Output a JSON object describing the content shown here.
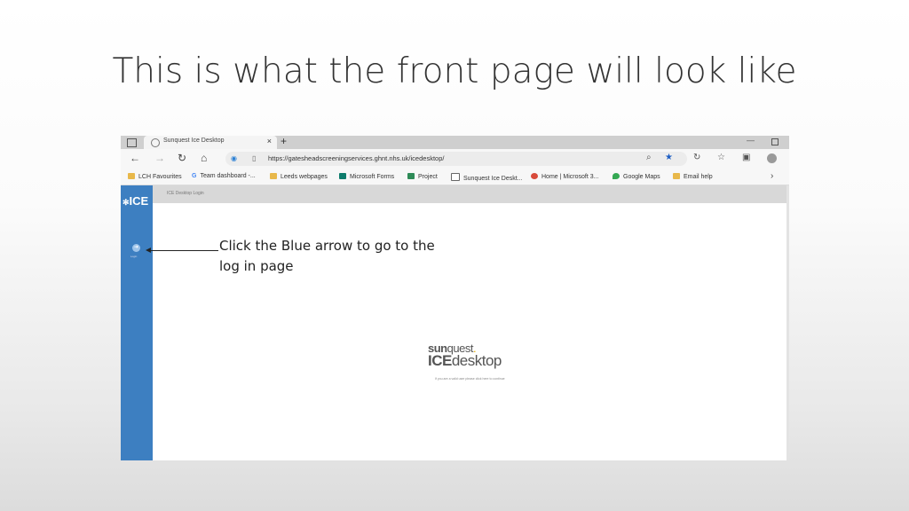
{
  "slide": {
    "title": "This is what the front page will look like",
    "annotation": "Click the Blue arrow to go to the log in page"
  },
  "browser": {
    "tab_title": "Sunquest Ice Desktop",
    "tab_close": "×",
    "new_tab": "+",
    "url": "https://gatesheadscreeningservices.ghnt.nhs.uk/icedesktop/",
    "bookmarks": [
      "LCH Favourites",
      "Team dashboard -...",
      "Leeds webpages",
      "Microsoft Forms",
      "Project",
      "Sunquest Ice Deskt...",
      "Home | Microsoft 3...",
      "Google Maps",
      "Email help"
    ]
  },
  "app": {
    "logo_small": "✻",
    "logo_text": "ICE",
    "topstrip_text": "ICE Desktop Login",
    "side_button_label": "Login",
    "brand_sun": "sun",
    "brand_quest": "quest",
    "brand_dot": ".",
    "brand_ice": "ICE",
    "brand_desktop": "desktop",
    "brand_sub": "If you are a valid user please click here to continue"
  },
  "colors": {
    "sidebar": "#3d7fc1",
    "accent": "#1f5fc4"
  }
}
